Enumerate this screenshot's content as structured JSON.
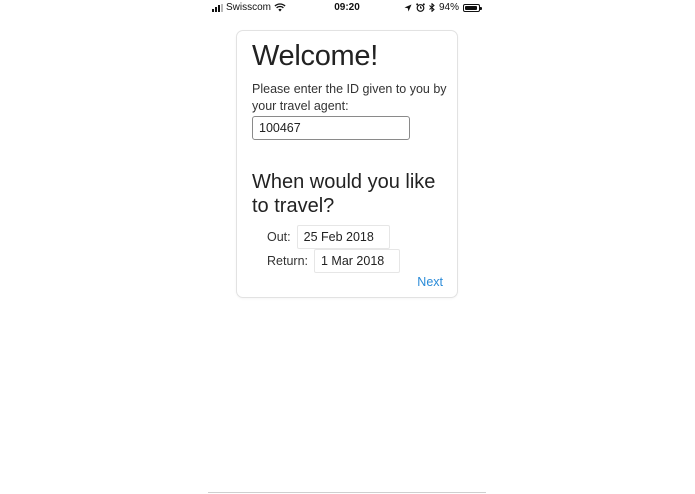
{
  "status_bar": {
    "carrier": "Swisscom",
    "time": "09:20",
    "battery_percent": "94%",
    "battery_level": 0.94
  },
  "card": {
    "title": "Welcome!",
    "prompt": "Please enter the ID given to you by your travel agent:",
    "id_value": "100467",
    "question": "When would you like to travel?",
    "out_label": "Out:",
    "out_date": "25 Feb 2018",
    "return_label": "Return:",
    "return_date": "1 Mar 2018",
    "next_label": "Next"
  },
  "colors": {
    "link": "#2a8bd8",
    "text": "#222222"
  }
}
